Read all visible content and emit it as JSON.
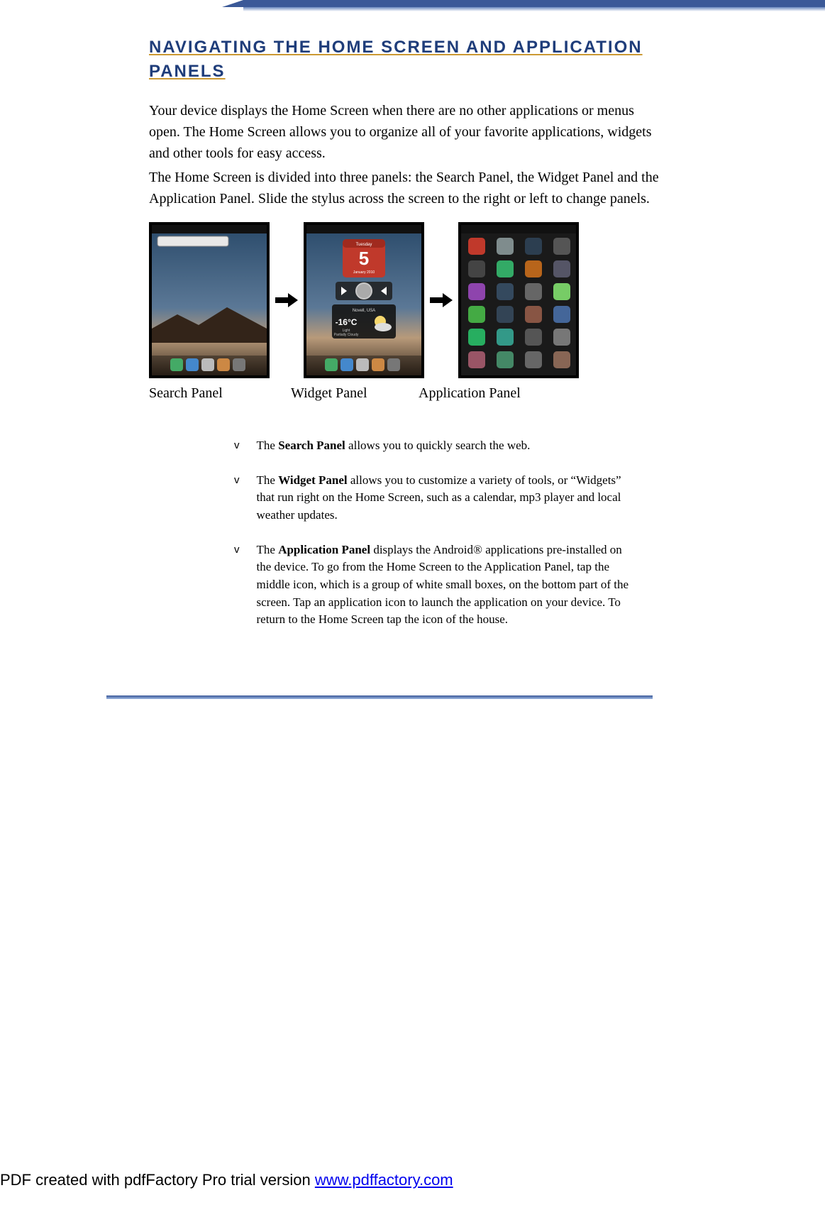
{
  "heading": "NAVIGATING THE HOME SCREEN AND APPLICATION PANELS",
  "para1": "Your device displays the Home Screen when there are no other applications or menus open. The Home Screen allows you to organize all of your favorite applications, widgets and other tools for easy access.",
  "para2": "The Home Screen is divided into three panels: the Search Panel, the Widget Panel and the Application Panel. Slide the stylus across the screen to the right or left to change panels.",
  "panelLabels": {
    "search": "Search Panel",
    "widget": "Widget Panel",
    "app": "Application Panel"
  },
  "widgetPanel": {
    "day": "Tuesday",
    "date": "5",
    "month": "January 2010",
    "location": "Novell, USA",
    "temp": "-16°C",
    "cond1": "Light",
    "cond2": "Partially Cloudy"
  },
  "bullets": [
    {
      "marker": "v",
      "bold": "Search Panel",
      "before": "The ",
      "after": " allows you to quickly search the web."
    },
    {
      "marker": "v",
      "bold": "Widget Panel",
      "before": "The ",
      "after": " allows you to customize a variety of tools, or “Widgets” that run right on the Home Screen, such as a calendar, mp3 player and local weather updates."
    },
    {
      "marker": "v",
      "bold": "Application Panel",
      "before": "The ",
      "after": " displays the Android® applications pre-installed on the device. To go from the Home Screen to the Application Panel, tap the middle icon, which is a group of white small boxes, on the bottom part of the screen. Tap an application icon to launch the application on your device. To return to the Home Screen tap the icon of the house."
    }
  ],
  "footer": {
    "prefix": "PDF created with pdfFactory Pro trial version ",
    "linkText": "www.pdffactory.com"
  }
}
